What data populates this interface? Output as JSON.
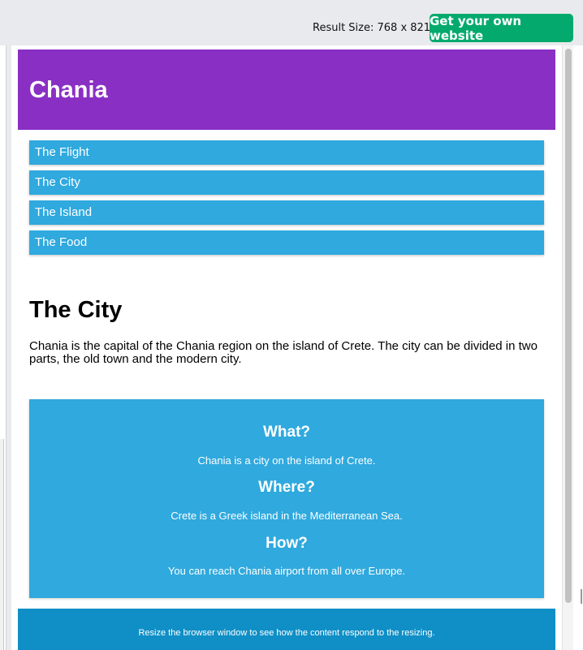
{
  "toolbar": {
    "result_size": "Result Size: 768 x 821",
    "get_website_label": "Get your own website"
  },
  "page": {
    "header_title": "Chania",
    "menu": [
      "The Flight",
      "The City",
      "The Island",
      "The Food"
    ],
    "content_title": "The City",
    "content_text": "Chania is the capital of the Chania region on the island of Crete. The city can be divided in two parts, the old town and the modern city.",
    "aside": [
      {
        "q": "What?",
        "a": "Chania is a city on the island of Crete."
      },
      {
        "q": "Where?",
        "a": "Crete is a Greek island in the Mediterranean Sea."
      },
      {
        "q": "How?",
        "a": "You can reach Chania airport from all over Europe."
      }
    ],
    "footer_text": "Resize the browser window to see how the content respond to the resizing."
  },
  "colors": {
    "header": "#8a2fc4",
    "menu": "#2fa9de",
    "aside": "#2fa9de",
    "footer": "#0f8fc6",
    "button": "#04aa6d"
  }
}
